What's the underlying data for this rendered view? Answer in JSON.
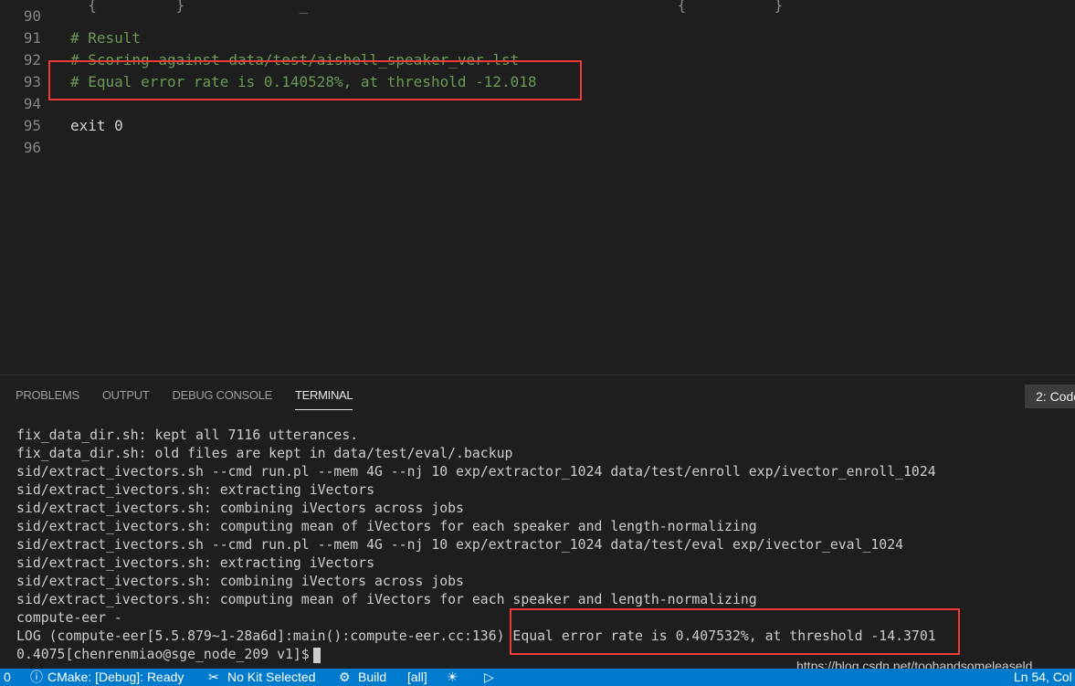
{
  "editor": {
    "lines": [
      {
        "num": "90",
        "text": ""
      },
      {
        "num": "91",
        "text": "# Result",
        "type": "comment"
      },
      {
        "num": "92",
        "text": "# Scoring against data/test/aishell_speaker_ver.lst",
        "type": "comment"
      },
      {
        "num": "93",
        "text": "# Equal error rate is 0.140528%, at threshold -12.018",
        "type": "comment"
      },
      {
        "num": "94",
        "text": ""
      },
      {
        "num": "95",
        "text": "exit 0"
      },
      {
        "num": "96",
        "text": ""
      }
    ]
  },
  "panel": {
    "tabs": [
      "PROBLEMS",
      "OUTPUT",
      "DEBUG CONSOLE",
      "TERMINAL"
    ],
    "active_tab": "TERMINAL",
    "terminal_select": "2: Code",
    "terminal_lines": [
      "fix_data_dir.sh: kept all 7116 utterances.",
      "fix_data_dir.sh: old files are kept in data/test/eval/.backup",
      "sid/extract_ivectors.sh --cmd run.pl --mem 4G --nj 10 exp/extractor_1024 data/test/enroll exp/ivector_enroll_1024",
      "sid/extract_ivectors.sh: extracting iVectors",
      "sid/extract_ivectors.sh: combining iVectors across jobs",
      "sid/extract_ivectors.sh: computing mean of iVectors for each speaker and length-normalizing",
      "sid/extract_ivectors.sh --cmd run.pl --mem 4G --nj 10 exp/extractor_1024 data/test/eval exp/ivector_eval_1024",
      "sid/extract_ivectors.sh: extracting iVectors",
      "sid/extract_ivectors.sh: combining iVectors across jobs",
      "sid/extract_ivectors.sh: computing mean of iVectors for each speaker and length-normalizing",
      "compute-eer -",
      "LOG (compute-eer[5.5.879~1-28a6d]:main():compute-eer.cc:136) Equal error rate is 0.407532%, at threshold -14.3701",
      "0.4075[chenrenmiao@sge_node_209 v1]$"
    ]
  },
  "status": {
    "problems": "0",
    "cmake": "CMake: [Debug]: Ready",
    "kit": "No Kit Selected",
    "build": "Build",
    "target": "[all]",
    "position": "Ln 54, Col"
  },
  "watermark": "https://blog.csdn.net/toohandsomeleaseld",
  "colors": {
    "highlight_box": "#f03a3a",
    "status_bar": "#007acc",
    "comment": "#6a9955"
  }
}
